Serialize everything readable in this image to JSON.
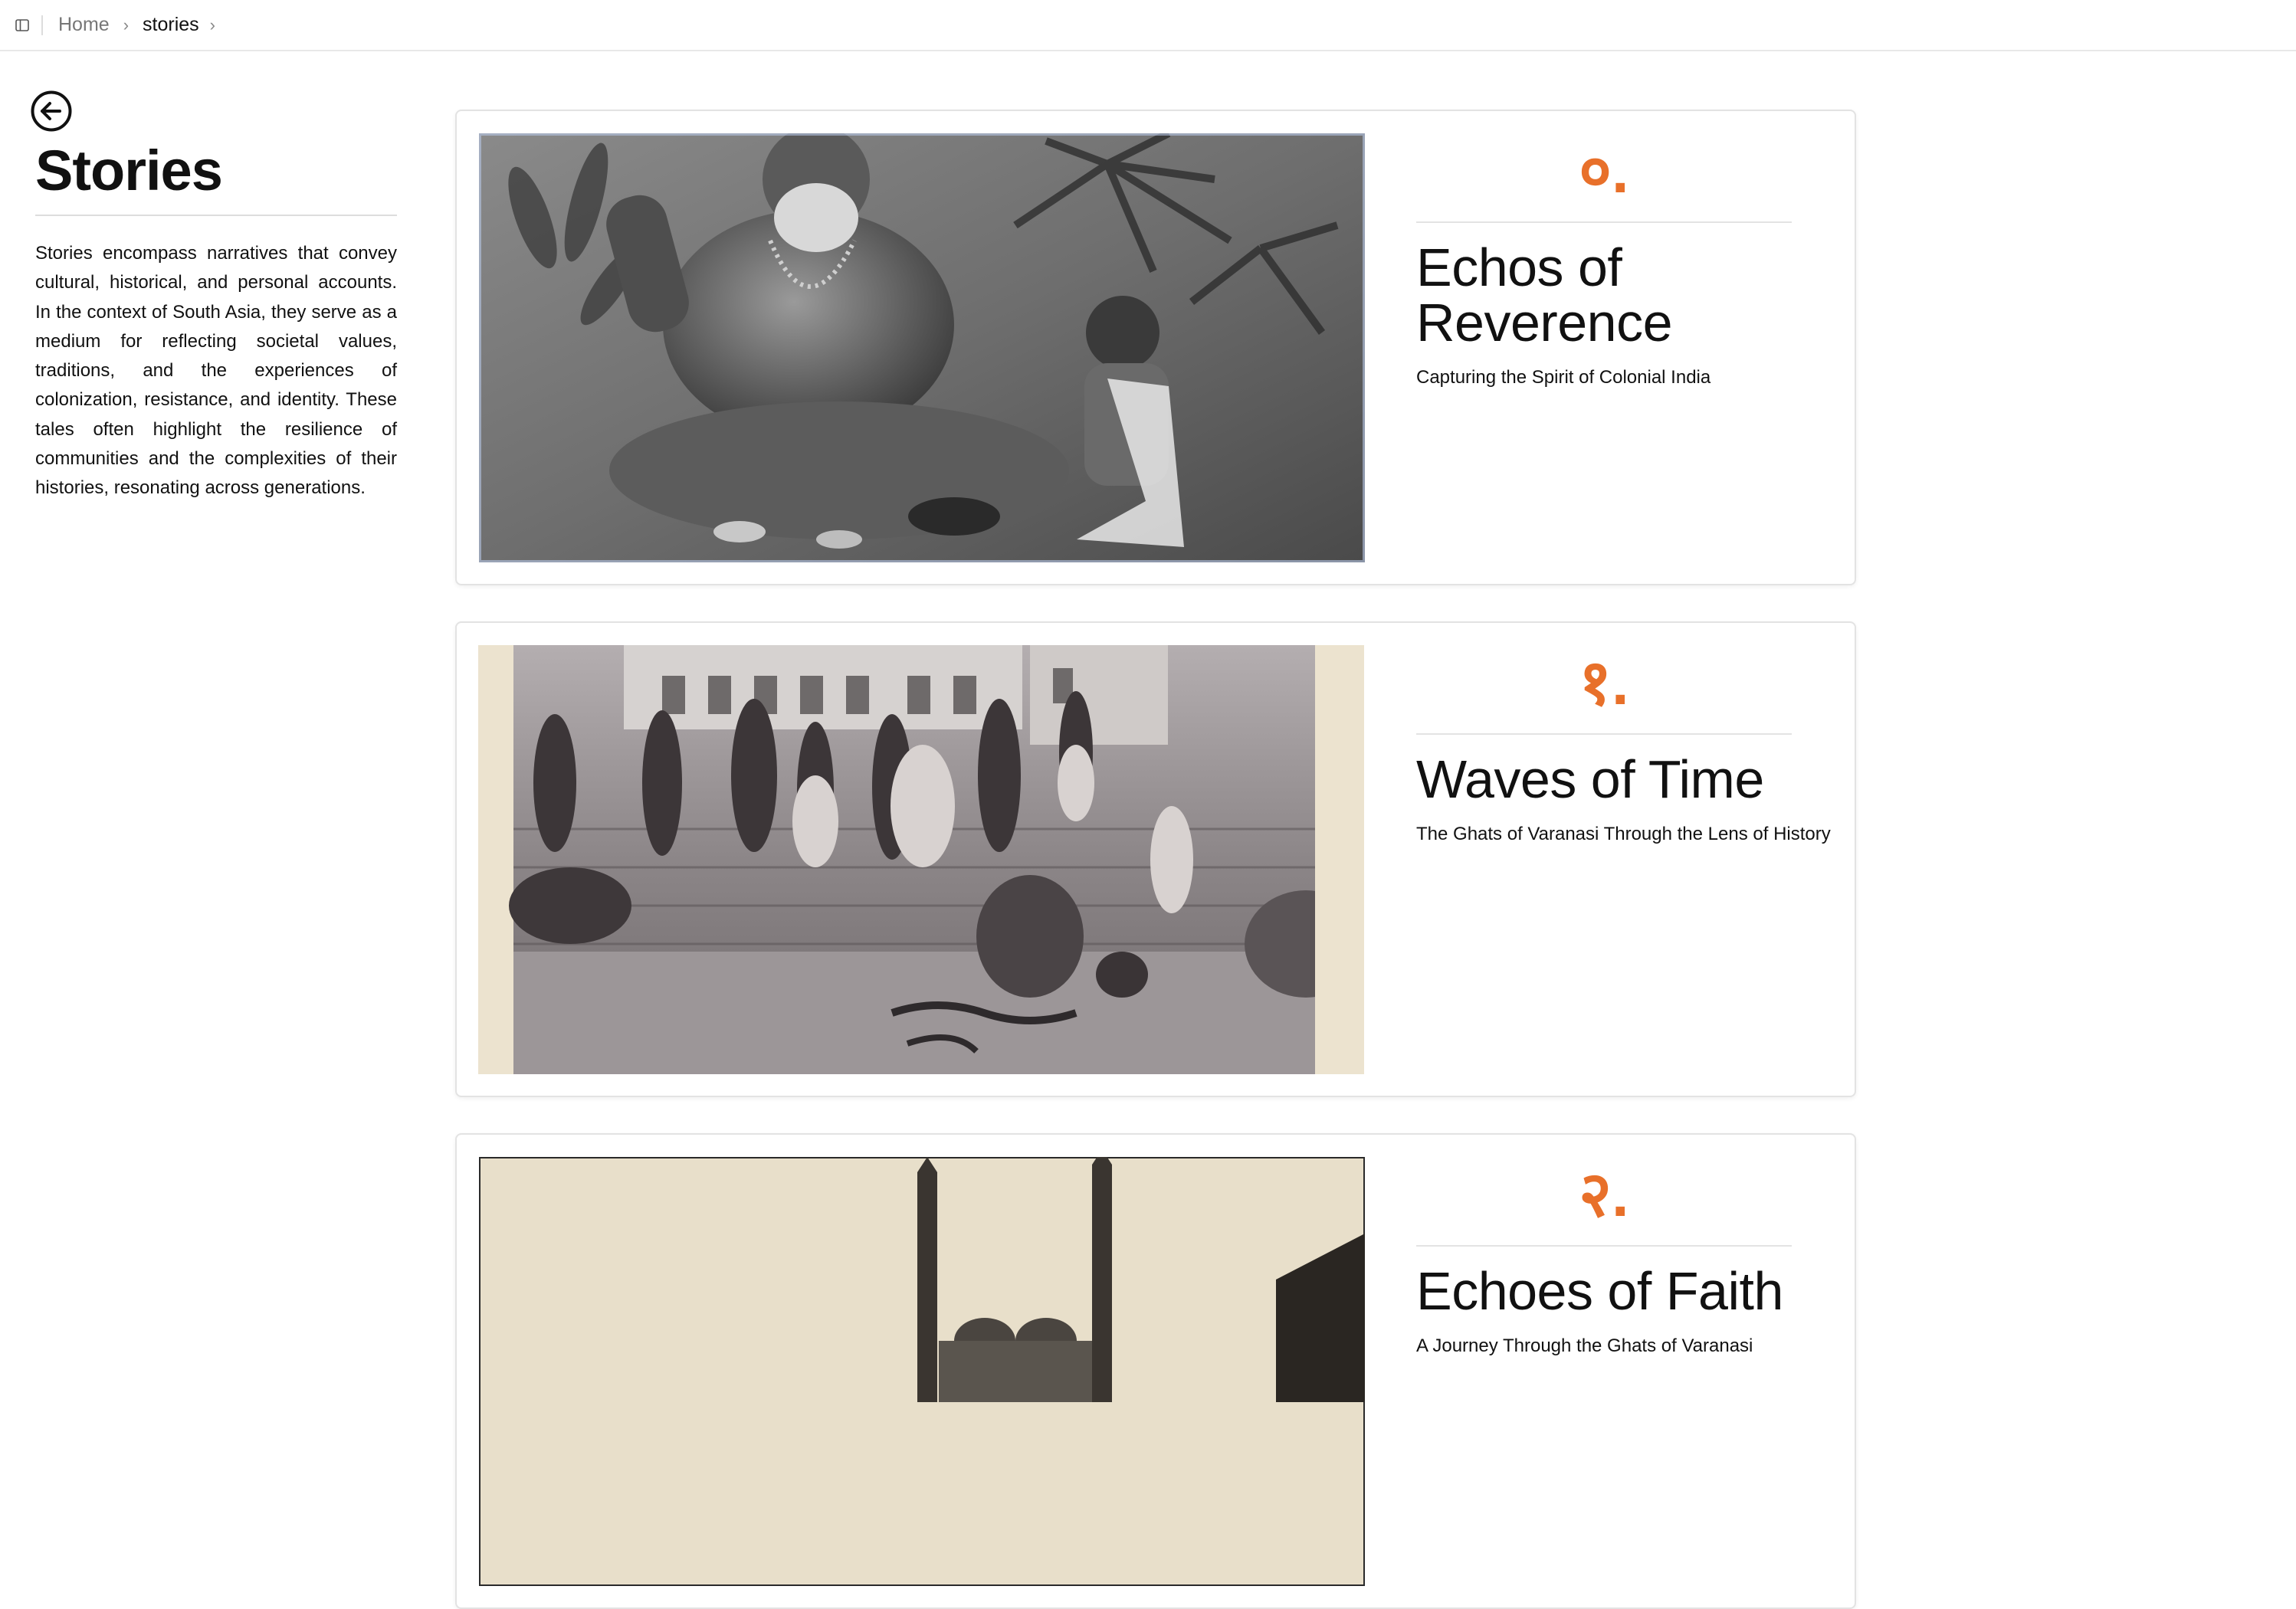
{
  "breadcrumb": {
    "items": [
      {
        "label": "Home"
      },
      {
        "label": "stories"
      }
    ]
  },
  "icons": {
    "sidebar_toggle": "sidebar-panel-icon",
    "back": "arrow-left-circle-icon",
    "separator": "chevron-right-icon"
  },
  "page": {
    "title": "Stories",
    "description": "Stories encompass narratives that convey cultural, historical, and personal accounts. In the context of South Asia, they serve as a medium for reflecting societal values, traditions, and the experiences of colonization, resistance, and identity. These tales often highlight the resilience of communities and the complexities of their histories, resonating across generations."
  },
  "colors": {
    "accent": "#e8702a",
    "card_border": "#e3e3e3"
  },
  "stories": [
    {
      "numeral": "०.",
      "title": "Echos of Reverence",
      "subtitle": "Capturing the Spirit of Colonial India"
    },
    {
      "numeral": "१.",
      "title": "Waves of Time",
      "subtitle": "The Ghats of Varanasi Through the Lens of History"
    },
    {
      "numeral": "२.",
      "title": "Echoes of Faith",
      "subtitle": "A Journey Through the Ghats of Varanasi"
    }
  ]
}
